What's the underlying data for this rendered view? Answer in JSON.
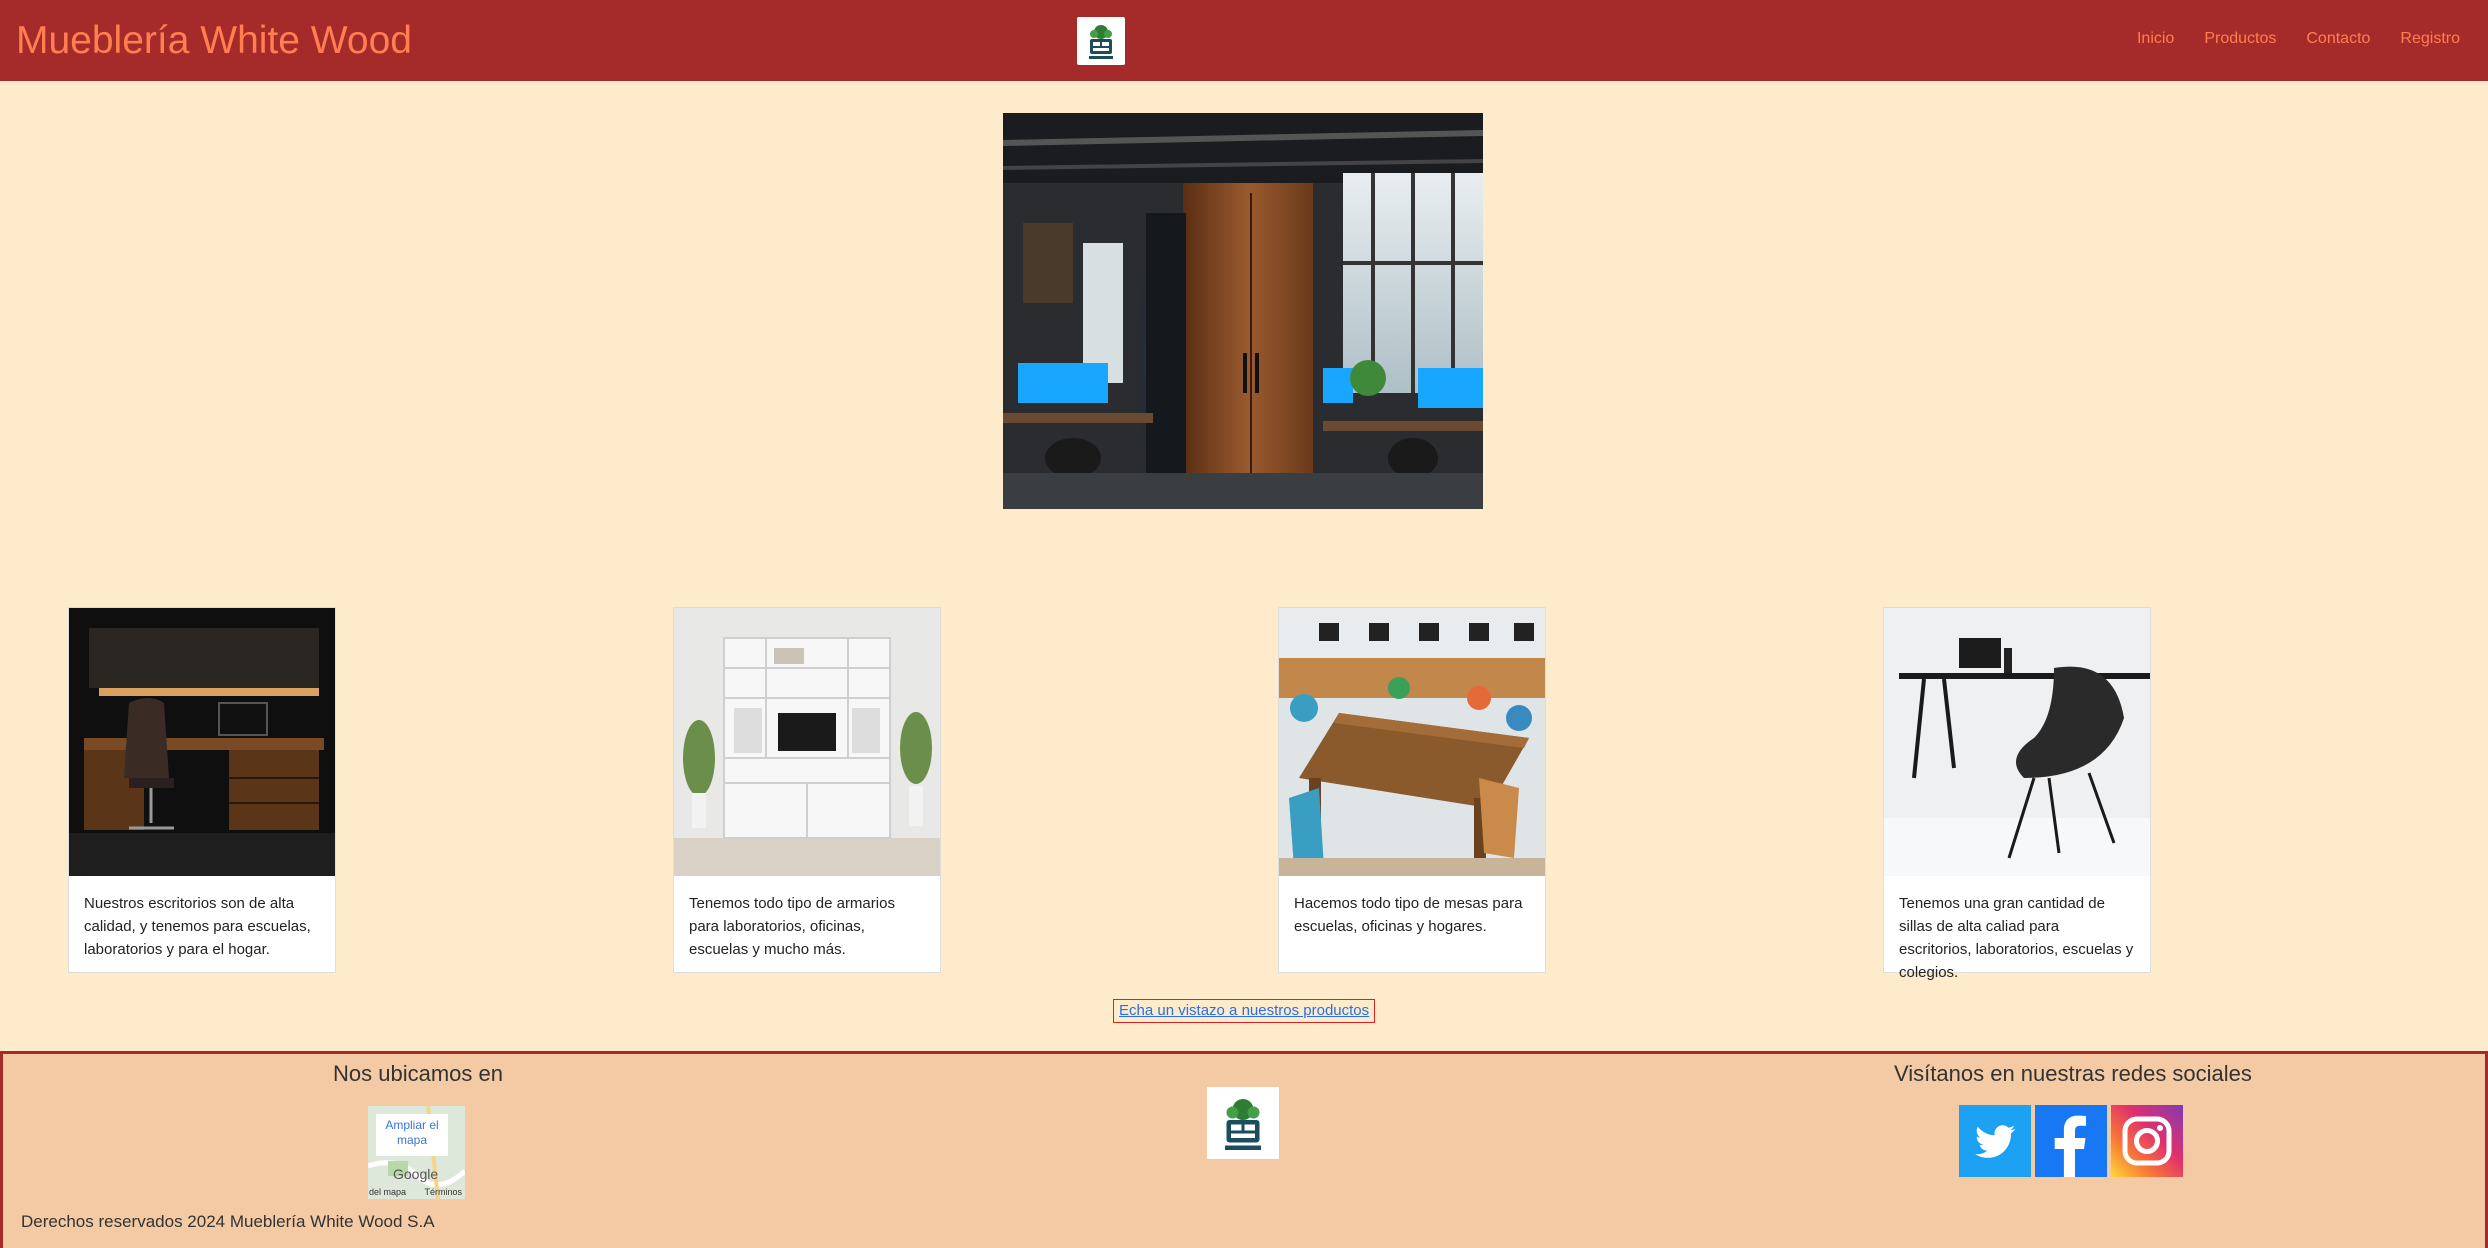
{
  "header": {
    "brand": "Mueblería White Wood",
    "logo_icon": "furniture-logo-icon",
    "nav": [
      {
        "label": "Inicio"
      },
      {
        "label": "Productos"
      },
      {
        "label": "Contacto"
      },
      {
        "label": "Registro"
      }
    ]
  },
  "hero": {
    "image": "office-wardrobe-photo"
  },
  "cards": [
    {
      "image": "desk-photo",
      "text": "Nuestros escritorios son de alta calidad, y tenemos para escuelas, laboratorios y para el hogar."
    },
    {
      "image": "shelving-unit-photo",
      "text": "Tenemos todo tipo de armarios para laboratorios, oficinas, escuelas y mucho más."
    },
    {
      "image": "wooden-table-photo",
      "text": "Hacemos todo tipo de mesas para escuelas, oficinas y hogares."
    },
    {
      "image": "chair-photo",
      "text": "Tenemos una gran cantidad de sillas de alta caliad para escritorios, laboratorios, escuelas y colegios."
    }
  ],
  "cta": {
    "label": "Echa un vistazo a nuestros productos"
  },
  "footer": {
    "location_title": "Nos ubicamos en",
    "map": {
      "enlarge": "Ampliar el mapa",
      "brand": "Google",
      "data": "del mapa",
      "terms": "Términos"
    },
    "social_title": "Visítanos en nuestras redes sociales",
    "social": [
      {
        "icon": "twitter-icon"
      },
      {
        "icon": "facebook-icon"
      },
      {
        "icon": "instagram-icon"
      }
    ],
    "copyright": "Derechos reservados 2024 Mueblería White Wood S.A"
  },
  "colors": {
    "header_bg": "#a52a2a",
    "accent": "#ff7f50",
    "page_bg": "#feebcb",
    "footer_bg": "#f3caa3",
    "link": "#2a6ee8"
  }
}
